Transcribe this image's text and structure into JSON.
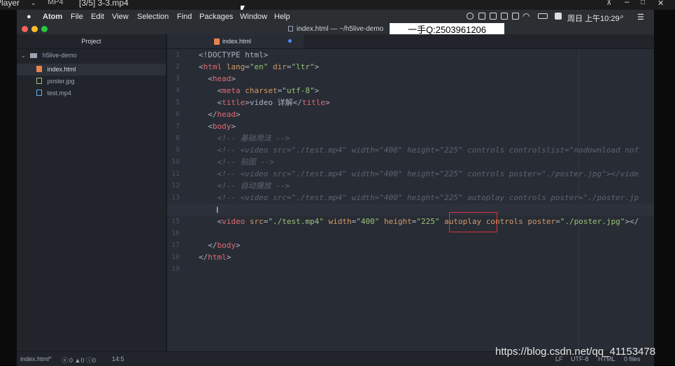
{
  "player": {
    "app_fragment": "Player",
    "format": "MP4",
    "file_title": "[3/5] 3-3.mp4"
  },
  "menubar": {
    "app_name": "Atom",
    "items": [
      "File",
      "Edit",
      "View",
      "Selection",
      "Find",
      "Packages",
      "Window",
      "Help"
    ],
    "clock": "周日 上午10:29"
  },
  "window": {
    "title": "index.html — ~/h5live-demo"
  },
  "overlay_text": "一手Q:2503961206",
  "tree": {
    "header": "Project",
    "root": "h5live-demo",
    "files": [
      "index.html",
      "poster.jpg",
      "test.mp4"
    ]
  },
  "tab": {
    "label": "index.html"
  },
  "editor": {
    "lines": [
      "<!DOCTYPE html>",
      "<html lang=\"en\" dir=\"ltr\">",
      "  <head>",
      "    <meta charset=\"utf-8\">",
      "    <title>video 详解</title>",
      "  </head>",
      "  <body>",
      "    <!-- 基础用法 -->",
      "    <!-- <video src=\"./test.mp4\" width=\"400\" height=\"225\" controls controlslist=\"nodownload nof",
      "    <!-- 贴图 -->",
      "    <!-- <video src=\"./test.mp4\" width=\"400\" height=\"225\" controls poster=\"./poster.jpg\"></vide",
      "    <!-- 自动播放 -->",
      "    <!-- <video src=\"./test.mp4\" width=\"400\" height=\"225\" autoplay controls poster=\"./poster.jp",
      "",
      "    <video src=\"./test.mp4\" width=\"400\" height=\"225\" autoplay controls poster=\"./poster.jpg\"></",
      "",
      "  </body>",
      "</html>",
      ""
    ],
    "current_line": 14
  },
  "status": {
    "file": "index.html*",
    "diagnostics": "0 ▲0 ⓘ0",
    "cursor_pos": "14:5",
    "line_ending": "LF",
    "encoding": "UTF-8",
    "grammar": "HTML",
    "git": "0 files"
  },
  "watermark": "https://blog.csdn.net/qq_41153478",
  "colors": {
    "tag": "#e06c75",
    "attribute": "#d19a66",
    "string": "#98c379",
    "comment": "#5c6370",
    "highlight_box": "#e0303a"
  }
}
